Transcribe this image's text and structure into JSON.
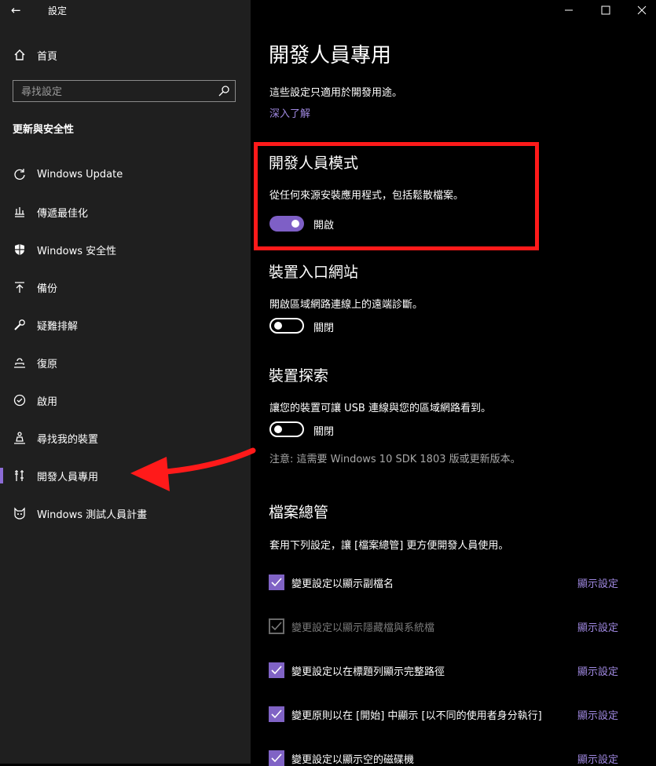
{
  "window": {
    "title": "設定",
    "minimize_icon": "minimize-icon",
    "maximize_icon": "maximize-icon",
    "close_icon": "close-icon"
  },
  "sidebar": {
    "home_label": "首頁",
    "search_placeholder": "尋找設定",
    "section_title": "更新與安全性",
    "items": [
      {
        "label": "Windows Update",
        "icon": "refresh-icon"
      },
      {
        "label": "傳遞最佳化",
        "icon": "delivery-icon"
      },
      {
        "label": "Windows 安全性",
        "icon": "shield-icon"
      },
      {
        "label": "備份",
        "icon": "backup-arrow-icon"
      },
      {
        "label": "疑難排解",
        "icon": "wrench-icon"
      },
      {
        "label": "復原",
        "icon": "recovery-icon"
      },
      {
        "label": "啟用",
        "icon": "check-circle-icon"
      },
      {
        "label": "尋找我的裝置",
        "icon": "person-location-icon"
      },
      {
        "label": "開發人員專用",
        "icon": "developer-tools-icon",
        "active": true
      },
      {
        "label": "Windows 測試人員計畫",
        "icon": "insider-cat-icon"
      }
    ]
  },
  "main": {
    "title": "開發人員專用",
    "intro": "這些設定只適用於開發用途。",
    "learn_more": "深入了解",
    "dev_mode": {
      "heading": "開發人員模式",
      "desc": "從任何來源安裝應用程式，包括鬆散檔案。",
      "state": "開啟",
      "on": true
    },
    "device_portal": {
      "heading": "裝置入口網站",
      "desc": "開啟區域網路連線上的遠端診斷。",
      "state": "關閉",
      "on": false
    },
    "device_discovery": {
      "heading": "裝置探索",
      "desc": "讓您的裝置可讓 USB 連線與您的區域網路看到。",
      "state": "關閉",
      "on": false,
      "note": "注意: 這需要 Windows 10 SDK 1803 版或更新版本。"
    },
    "file_explorer": {
      "heading": "檔案總管",
      "desc": "套用下列設定，讓 [檔案總管] 更方便開發人員使用。",
      "show_label": "顯示設定",
      "rows": [
        {
          "label": "變更設定以顯示副檔名",
          "checked": true,
          "dim": false
        },
        {
          "label": "變更設定以顯示隱藏檔與系統檔",
          "checked": true,
          "dim": true
        },
        {
          "label": "變更設定以在標題列顯示完整路徑",
          "checked": true,
          "dim": false
        },
        {
          "label": "變更原則以在 [開始] 中顯示 [以不同的使用者身分執行]",
          "checked": true,
          "dim": false
        },
        {
          "label": "變更設定以顯示空的磁碟機",
          "checked": true,
          "dim": false
        }
      ]
    }
  },
  "colors": {
    "accent": "#8063c5",
    "link": "#9f88e0",
    "highlight": "#ff1a1a",
    "sidebar_bg": "#1f1f1f",
    "main_bg": "#000000"
  }
}
